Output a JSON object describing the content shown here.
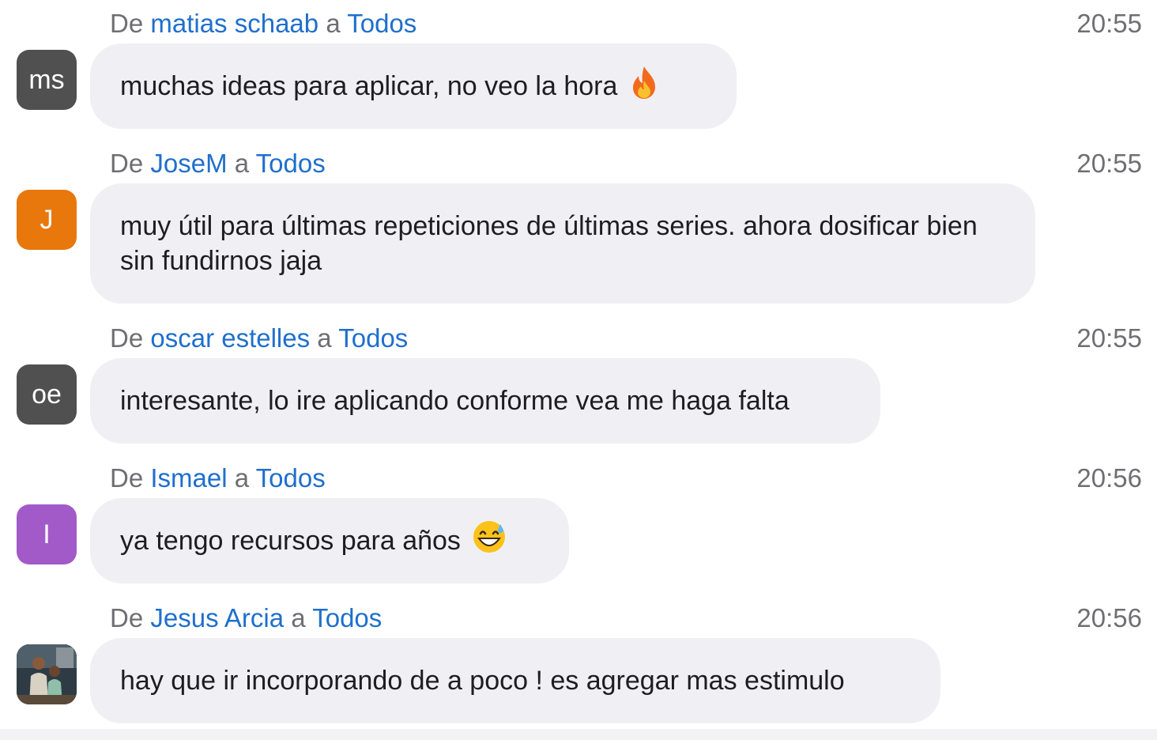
{
  "labels": {
    "from": "De",
    "to": "a"
  },
  "colors": {
    "link": "#1f6fcc",
    "meta_gray": "#6f6f73",
    "bubble": "#f0f0f4"
  },
  "messages": [
    {
      "sender": "matias schaab",
      "recipient": "Todos",
      "time": "20:55",
      "avatar_initials": "ms",
      "avatar_color": "#505050",
      "text": "muchas ideas para aplicar, no veo la hora",
      "emoji": "fire-icon"
    },
    {
      "sender": "JoseM",
      "recipient": "Todos",
      "time": "20:55",
      "avatar_initials": "J",
      "avatar_color": "#e8770c",
      "text": "muy útil para últimas repeticiones de últimas series. ahora dosificar bien sin fundirnos jaja"
    },
    {
      "sender": "oscar estelles",
      "recipient": "Todos",
      "time": "20:55",
      "avatar_initials": "oe",
      "avatar_color": "#505050",
      "text": "interesante, lo ire aplicando conforme vea me haga falta"
    },
    {
      "sender": "Ismael",
      "recipient": "Todos",
      "time": "20:56",
      "avatar_initials": "I",
      "avatar_color": "#a25ac8",
      "text": "ya tengo recursos para años",
      "emoji": "grinning-sweat-icon"
    },
    {
      "sender": "Jesus Arcia",
      "recipient": "Todos",
      "time": "20:56",
      "avatar_initials": "",
      "avatar_color": "#3c4a50",
      "text": "hay que ir incorporando de a poco ! es agregar mas estimulo",
      "avatar_photo": "photo-avatar-icon"
    }
  ]
}
